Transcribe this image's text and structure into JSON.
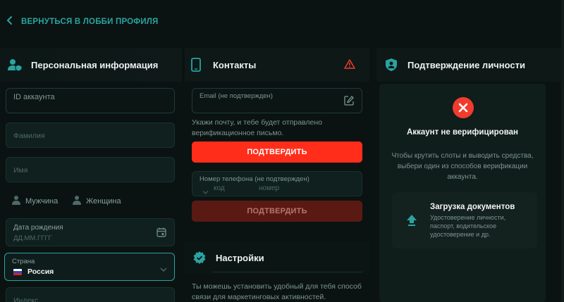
{
  "back": {
    "label": "ВЕРНУТЬСЯ В ЛОББИ ПРОФИЛЯ",
    "icon": "chevron-left-icon"
  },
  "personal": {
    "title": "Персональная информация",
    "account_id_label": "ID аккаунта",
    "lastname_placeholder": "Фамилия",
    "firstname_placeholder": "Имя",
    "gender_male": "Мужчина",
    "gender_female": "Женщина",
    "birthdate_label": "Дата рождения",
    "birthdate_placeholder": "ДД.ММ.ГГГГ",
    "country_label": "Страна",
    "country_value": "Россия",
    "index_placeholder": "Индекс"
  },
  "contacts": {
    "title": "Контакты",
    "email_label": "Email (не подтвержден)",
    "email_hint": "Укажи почту, и тебе будет отправлено верификационное письмо.",
    "confirm_label": "ПОДТВЕРДИТЬ",
    "phone_label": "Номер телефона (не подтвержден)",
    "phone_code_placeholder": "код",
    "phone_number_placeholder": "номер",
    "confirm_phone_label": "ПОДТВЕРДИТЬ"
  },
  "settings": {
    "title": "Настройки",
    "text": "Ты можешь установить удобный для тебя способ связи для маркетинговых активностей."
  },
  "verification": {
    "title": "Подтверждение личности",
    "status": "Аккаунт не верифицирован",
    "description": "Чтобы крутить слоты и выводить средства, выбери один из способов верификации аккаунта.",
    "upload_title": "Загрузка документов",
    "upload_desc": "Удостоверение личности, паспорт, водительское удостоверение и др."
  },
  "colors": {
    "accent": "#2aa3a0",
    "primary": "#ff2d1a",
    "danger": "#f03b2d"
  }
}
